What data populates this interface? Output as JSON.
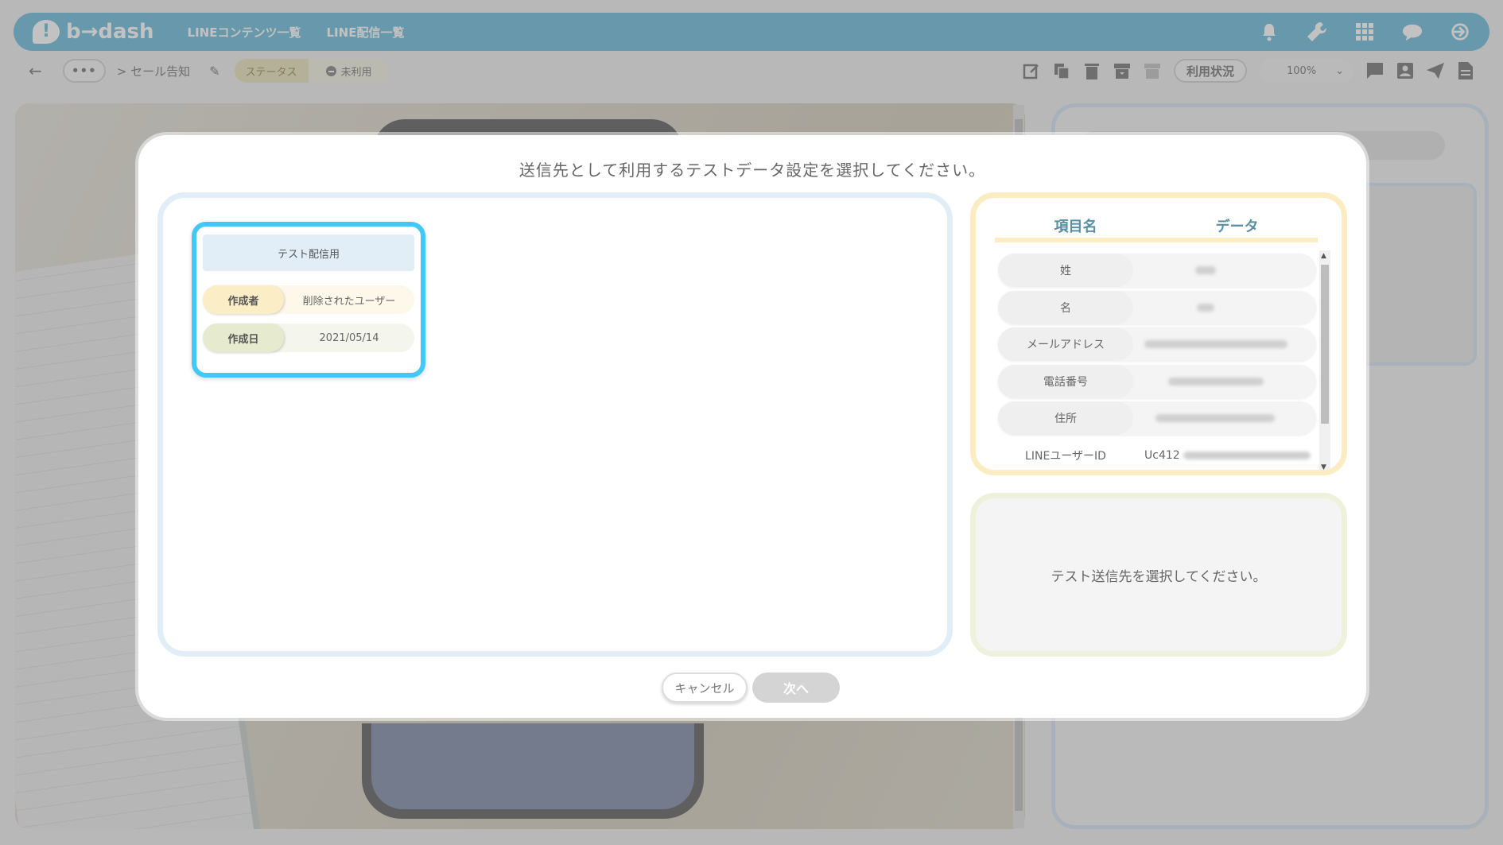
{
  "header": {
    "logo_text": "b→dash",
    "nav": [
      "LINEコンテンツ一覧",
      "LINE配信一覧"
    ],
    "icons": [
      "bell-icon",
      "wrench-icon",
      "grid-icon",
      "chat-icon",
      "logout-icon"
    ]
  },
  "toolbar": {
    "back": "←",
    "more": "•••",
    "breadcrumb": "> セール告知",
    "status_label": "ステータス",
    "status_value": "未利用",
    "usage_button": "利用状況",
    "zoom": "100%"
  },
  "modal": {
    "title": "送信先として利用するテストデータ設定を選択してください。",
    "card": {
      "title": "テスト配信用",
      "creator_label": "作成者",
      "creator_value": "削除されたユーザー",
      "date_label": "作成日",
      "date_value": "2021/05/14"
    },
    "data_table": {
      "col_item": "項目名",
      "col_data": "データ",
      "rows": [
        {
          "key": "姓"
        },
        {
          "key": "名"
        },
        {
          "key": "メールアドレス"
        },
        {
          "key": "電話番号"
        },
        {
          "key": "住所"
        },
        {
          "key": "LINEユーザーID",
          "value": "Uc412"
        }
      ]
    },
    "preview_message": "テスト送信先を選択してください。",
    "cancel_label": "キャンセル",
    "next_label": "次へ"
  },
  "colors": {
    "header_bg": "#5ab3d5",
    "card_border": "#43c8f5",
    "highlight_dashed": "#f06276"
  }
}
